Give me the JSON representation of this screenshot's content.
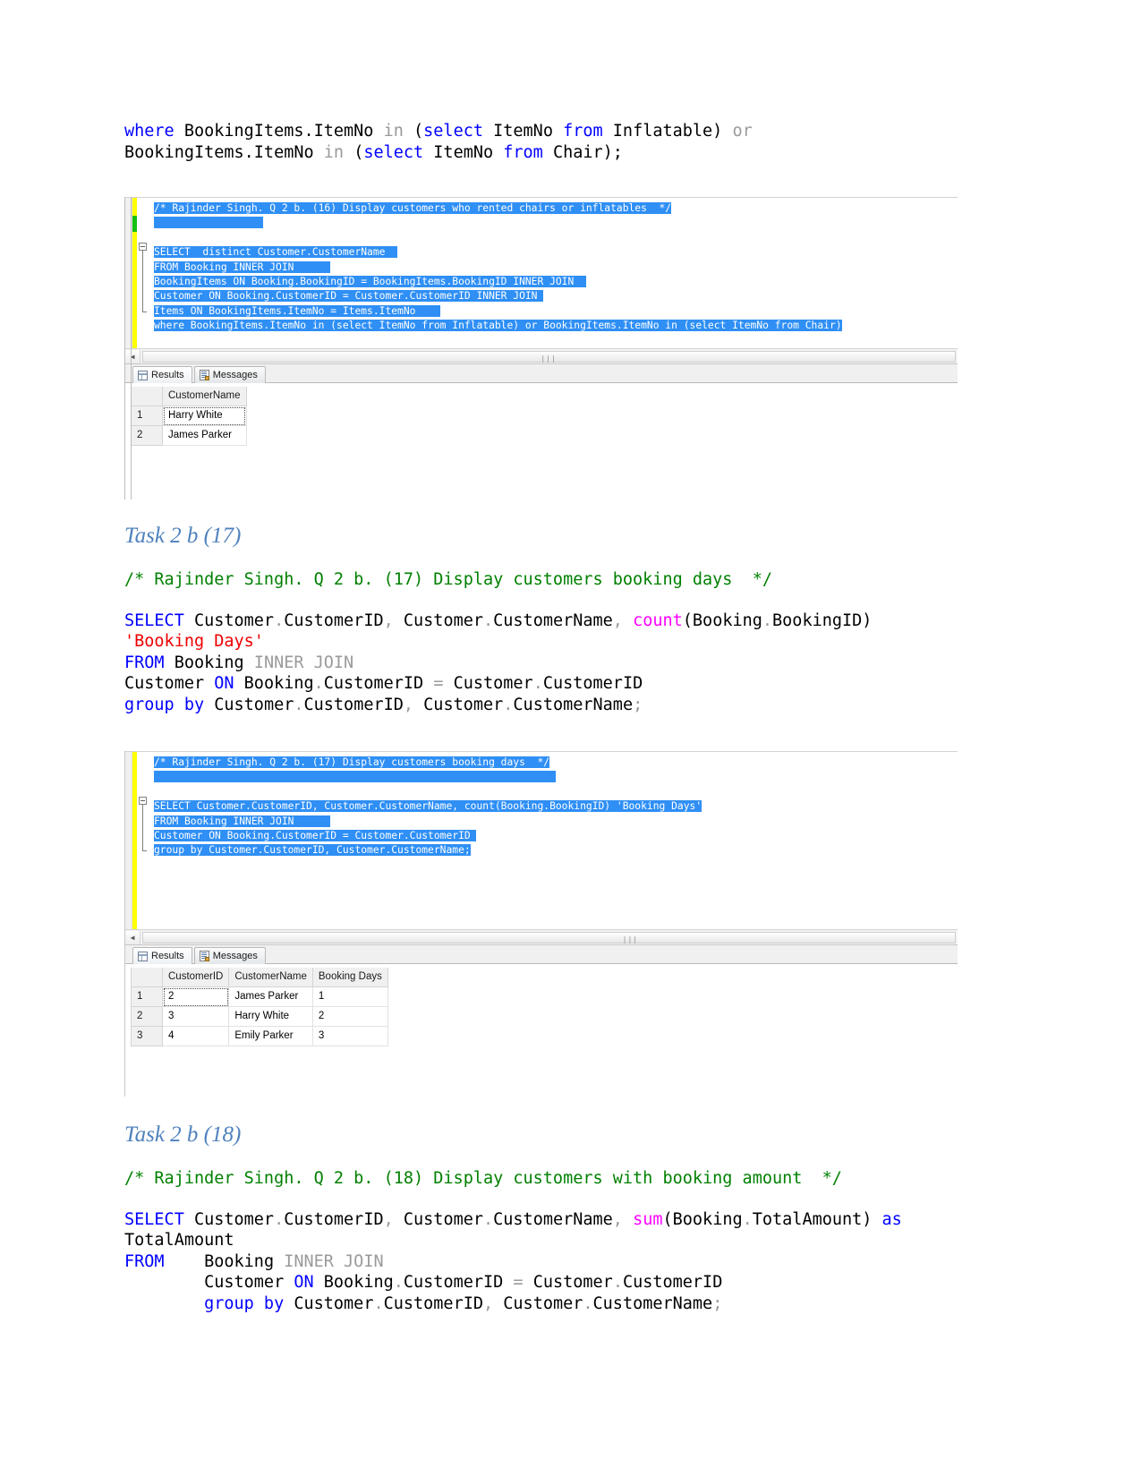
{
  "document": {
    "top_sql_lines": [
      [
        {
          "t": "where ",
          "c": "kw"
        },
        {
          "t": "BookingItems.ItemNo ",
          "c": "plain"
        },
        {
          "t": "in ",
          "c": "gray"
        },
        {
          "t": "(",
          "c": "plain"
        },
        {
          "t": "select ",
          "c": "kw"
        },
        {
          "t": "ItemNo ",
          "c": "plain"
        },
        {
          "t": "from ",
          "c": "kw"
        },
        {
          "t": "Inflatable) ",
          "c": "plain"
        },
        {
          "t": "or",
          "c": "gray"
        }
      ],
      [
        {
          "t": "BookingItems.ItemNo ",
          "c": "plain"
        },
        {
          "t": "in ",
          "c": "gray"
        },
        {
          "t": "(",
          "c": "plain"
        },
        {
          "t": "select ",
          "c": "kw"
        },
        {
          "t": "ItemNo ",
          "c": "plain"
        },
        {
          "t": "from ",
          "c": "kw"
        },
        {
          "t": "Chair);",
          "c": "plain"
        }
      ]
    ]
  },
  "screenshot_16": {
    "editor_lines": [
      {
        "text": "/* Rajinder Singh. Q 2 b. (16) Display customers who rented chairs or inflatables  */",
        "selected": true,
        "sel_extra": 0
      },
      {
        "text": "",
        "selected": true,
        "sel_extra": 18
      },
      {
        "text": "",
        "selected": false,
        "sel_extra": 0
      },
      {
        "text": "SELECT  distinct Customer.CustomerName",
        "selected": true,
        "sel_extra": 2,
        "squiggle_from": 17
      },
      {
        "text": "FROM Booking INNER JOIN",
        "selected": true,
        "sel_extra": 6
      },
      {
        "text": "BookingItems ON Booking.BookingID = BookingItems.BookingID INNER JOIN",
        "selected": true,
        "sel_extra": 2
      },
      {
        "text": "Customer ON Booking.CustomerID = Customer.CustomerID INNER JOIN",
        "selected": true,
        "sel_extra": 1
      },
      {
        "text": "Items ON BookingItems.ItemNo = Items.ItemNo",
        "selected": true,
        "sel_extra": 4
      },
      {
        "text": "where BookingItems.ItemNo in (select ItemNo from Inflatable) or BookingItems.ItemNo in (select ItemNo from Chair)",
        "selected": true,
        "sel_extra": 0
      }
    ],
    "results_tabs": [
      {
        "label": "Results",
        "icon": "grid-icon",
        "active": true
      },
      {
        "label": "Messages",
        "icon": "message-icon",
        "active": false
      }
    ],
    "grid": {
      "columns": [
        "CustomerName"
      ],
      "rows": [
        {
          "num": "1",
          "cells": [
            "Harry White"
          ],
          "focused": true
        },
        {
          "num": "2",
          "cells": [
            "James Parker"
          ],
          "focused": false
        }
      ]
    }
  },
  "task17": {
    "heading": "Task 2 b (17)",
    "comment": "/* Rajinder Singh. Q 2 b. (17) Display customers booking days  */",
    "sql_lines": [
      [
        {
          "t": "SELECT ",
          "c": "kw"
        },
        {
          "t": "Customer",
          "c": "plain"
        },
        {
          "t": ".",
          "c": "gray"
        },
        {
          "t": "CustomerID",
          "c": "plain"
        },
        {
          "t": ", ",
          "c": "gray"
        },
        {
          "t": "Customer",
          "c": "plain"
        },
        {
          "t": ".",
          "c": "gray"
        },
        {
          "t": "CustomerName",
          "c": "plain"
        },
        {
          "t": ", ",
          "c": "gray"
        },
        {
          "t": "count",
          "c": "fn"
        },
        {
          "t": "(Booking",
          "c": "plain"
        },
        {
          "t": ".",
          "c": "gray"
        },
        {
          "t": "BookingID)",
          "c": "plain"
        }
      ],
      [
        {
          "t": "'Booking Days'",
          "c": "str"
        }
      ],
      [
        {
          "t": "FROM ",
          "c": "kw"
        },
        {
          "t": "Booking ",
          "c": "plain"
        },
        {
          "t": "INNER JOIN",
          "c": "gray"
        }
      ],
      [
        {
          "t": "Customer ",
          "c": "plain"
        },
        {
          "t": "ON ",
          "c": "kw"
        },
        {
          "t": "Booking",
          "c": "plain"
        },
        {
          "t": ".",
          "c": "gray"
        },
        {
          "t": "CustomerID ",
          "c": "plain"
        },
        {
          "t": "= ",
          "c": "gray"
        },
        {
          "t": "Customer",
          "c": "plain"
        },
        {
          "t": ".",
          "c": "gray"
        },
        {
          "t": "CustomerID",
          "c": "plain"
        }
      ],
      [
        {
          "t": "group by ",
          "c": "kw"
        },
        {
          "t": "Customer",
          "c": "plain"
        },
        {
          "t": ".",
          "c": "gray"
        },
        {
          "t": "CustomerID",
          "c": "plain"
        },
        {
          "t": ", ",
          "c": "gray"
        },
        {
          "t": "Customer",
          "c": "plain"
        },
        {
          "t": ".",
          "c": "gray"
        },
        {
          "t": "CustomerName",
          "c": "plain"
        },
        {
          "t": ";",
          "c": "gray"
        }
      ]
    ]
  },
  "screenshot_17": {
    "editor_lines": [
      {
        "text": "/* Rajinder Singh. Q 2 b. (17) Display customers booking days  */",
        "selected": true,
        "sel_extra": 0
      },
      {
        "text": "",
        "selected": true,
        "sel_extra": 66
      },
      {
        "text": "",
        "selected": false,
        "sel_extra": 0
      },
      {
        "text": "SELECT Customer.CustomerID, Customer.CustomerName, count(Booking.BookingID) 'Booking Days'",
        "selected": true,
        "sel_extra": 0
      },
      {
        "text": "FROM Booking INNER JOIN",
        "selected": true,
        "sel_extra": 6
      },
      {
        "text": "Customer ON Booking.CustomerID = Customer.CustomerID",
        "selected": true,
        "sel_extra": 1
      },
      {
        "text": "group by Customer.CustomerID, Customer.CustomerName;",
        "selected": true,
        "sel_extra": 0
      }
    ],
    "results_tabs": [
      {
        "label": "Results",
        "icon": "grid-icon",
        "active": true
      },
      {
        "label": "Messages",
        "icon": "message-icon",
        "active": false
      }
    ],
    "grid": {
      "columns": [
        "CustomerID",
        "CustomerName",
        "Booking Days"
      ],
      "rows": [
        {
          "num": "1",
          "cells": [
            "2",
            "James Parker",
            "1"
          ],
          "focused": true
        },
        {
          "num": "2",
          "cells": [
            "3",
            "Harry White",
            "2"
          ],
          "focused": false
        },
        {
          "num": "3",
          "cells": [
            "4",
            "Emily Parker",
            "3"
          ],
          "focused": false
        }
      ]
    }
  },
  "task18": {
    "heading": "Task 2 b (18)",
    "comment": "/* Rajinder Singh. Q 2 b. (18) Display customers with booking amount  */",
    "sql_lines": [
      [
        {
          "t": "SELECT ",
          "c": "kw"
        },
        {
          "t": "Customer",
          "c": "plain"
        },
        {
          "t": ".",
          "c": "gray"
        },
        {
          "t": "CustomerID",
          "c": "plain"
        },
        {
          "t": ", ",
          "c": "gray"
        },
        {
          "t": "Customer",
          "c": "plain"
        },
        {
          "t": ".",
          "c": "gray"
        },
        {
          "t": "CustomerName",
          "c": "plain"
        },
        {
          "t": ", ",
          "c": "gray"
        },
        {
          "t": "sum",
          "c": "fn"
        },
        {
          "t": "(Booking",
          "c": "plain"
        },
        {
          "t": ".",
          "c": "gray"
        },
        {
          "t": "TotalAmount) ",
          "c": "plain"
        },
        {
          "t": "as",
          "c": "kw"
        }
      ],
      [
        {
          "t": "TotalAmount",
          "c": "plain"
        }
      ],
      [
        {
          "t": "FROM",
          "c": "kw"
        },
        {
          "t": "    Booking ",
          "c": "plain"
        },
        {
          "t": "INNER JOIN",
          "c": "gray"
        }
      ],
      [
        {
          "t": "        Customer ",
          "c": "plain"
        },
        {
          "t": "ON ",
          "c": "kw"
        },
        {
          "t": "Booking",
          "c": "plain"
        },
        {
          "t": ".",
          "c": "gray"
        },
        {
          "t": "CustomerID ",
          "c": "plain"
        },
        {
          "t": "= ",
          "c": "gray"
        },
        {
          "t": "Customer",
          "c": "plain"
        },
        {
          "t": ".",
          "c": "gray"
        },
        {
          "t": "CustomerID",
          "c": "plain"
        }
      ],
      [
        {
          "t": "        ",
          "c": "plain"
        },
        {
          "t": "group by ",
          "c": "kw"
        },
        {
          "t": "Customer",
          "c": "plain"
        },
        {
          "t": ".",
          "c": "gray"
        },
        {
          "t": "CustomerID",
          "c": "plain"
        },
        {
          "t": ", ",
          "c": "gray"
        },
        {
          "t": "Customer",
          "c": "plain"
        },
        {
          "t": ".",
          "c": "gray"
        },
        {
          "t": "CustomerName",
          "c": "plain"
        },
        {
          "t": ";",
          "c": "gray"
        }
      ]
    ]
  },
  "colors": {
    "keyword": "#0000ff",
    "function": "#ff00ff",
    "string": "#ee0000",
    "comment": "#008000",
    "operator_gray": "#9a9a9a",
    "heading": "#4f81bd",
    "selection": "#2f8ff5",
    "changebar_yellow": "#ffff00",
    "changebar_green": "#13c113"
  }
}
